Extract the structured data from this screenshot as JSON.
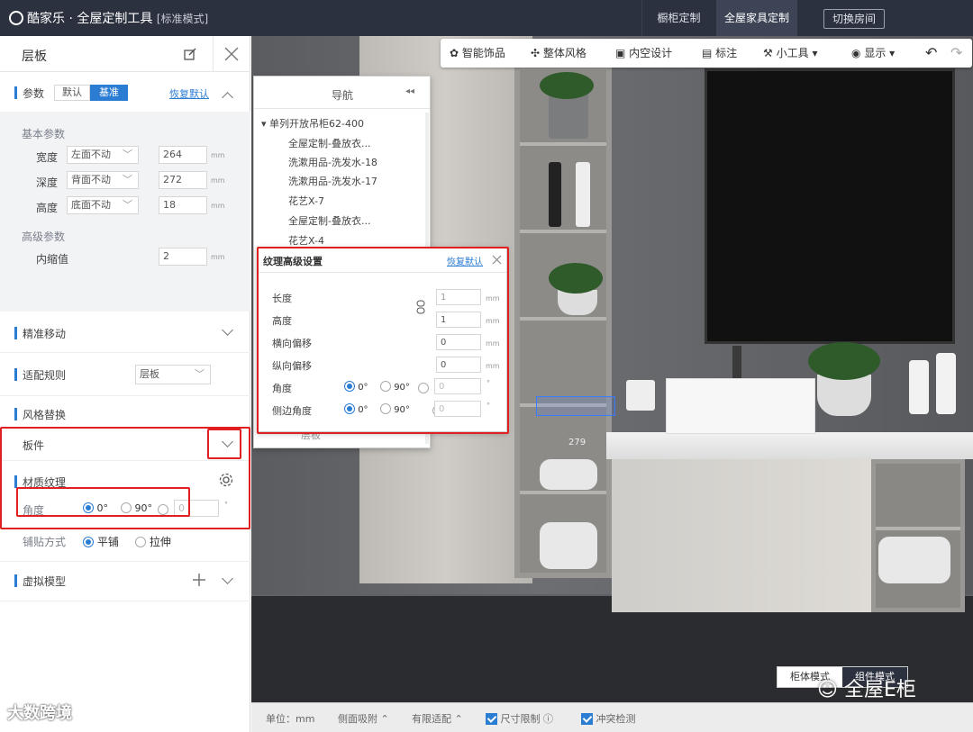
{
  "app": {
    "title": "酷家乐 · 全屋定制工具",
    "mode": "[标准模式]",
    "tabs": [
      "橱柜定制",
      "全屋家具定制"
    ],
    "switch_room": "切换房间"
  },
  "left_panel": {
    "title": "层板",
    "params": {
      "label": "参数",
      "toggle": [
        "默认",
        "基准"
      ],
      "reset": "恢复默认",
      "basic_title": "基本参数",
      "rows": [
        {
          "label": "宽度",
          "anchor": "左面不动",
          "value": "264",
          "unit": "mm"
        },
        {
          "label": "深度",
          "anchor": "背面不动",
          "value": "272",
          "unit": "mm"
        },
        {
          "label": "高度",
          "anchor": "底面不动",
          "value": "18",
          "unit": "mm"
        }
      ],
      "advanced_title": "高级参数",
      "inset": {
        "label": "内缩值",
        "value": "2",
        "unit": "mm"
      }
    },
    "precise_move": "精准移动",
    "fit_rules": {
      "label": "适配规则",
      "value": "层板"
    },
    "style_replace": {
      "label": "风格替换",
      "sub": "板件"
    },
    "material": {
      "label": "材质纹理",
      "angle_label": "角度",
      "angle_options": [
        "0°",
        "90°"
      ],
      "angle_custom": "0",
      "angle_unit": "°",
      "tile_label": "铺贴方式",
      "tile_options": [
        "平铺",
        "拉伸"
      ]
    },
    "virtual_model": "虚拟模型"
  },
  "toolbar": [
    "智能饰品",
    "整体风格",
    "内空设计",
    "标注",
    "小工具",
    "显示"
  ],
  "navigator": {
    "title": "导航",
    "root": "单列开放吊柜62-400",
    "items": [
      "全屋定制-叠放衣...",
      "洗漱用品-洗发水-18",
      "洗漱用品-洗发水-17",
      "花艺X-7",
      "全屋定制-叠放衣...",
      "花艺X-4"
    ],
    "tail": "层板"
  },
  "texture_dialog": {
    "title": "纹理高级设置",
    "reset": "恢复默认",
    "rows": [
      {
        "label": "长度",
        "value": "1",
        "unit": "mm"
      },
      {
        "label": "高度",
        "value": "1",
        "unit": "mm"
      },
      {
        "label": "横向偏移",
        "value": "0",
        "unit": "mm"
      },
      {
        "label": "纵向偏移",
        "value": "0",
        "unit": "mm"
      }
    ],
    "angle_label": "角度",
    "side_angle_label": "侧边角度",
    "angle_options": [
      "0°",
      "90°"
    ],
    "angle_custom": "0",
    "angle_unit": "°"
  },
  "scene": {
    "dimension_label": "279"
  },
  "view_toggle": [
    "柜体模式",
    "组件模式"
  ],
  "statusbar": {
    "unit": "单位：mm",
    "side_snap": "侧面吸附",
    "limited_fit": "有限适配",
    "size_limit": "尺寸限制",
    "collision": "冲突检测"
  },
  "watermarks": [
    "大数跨境",
    "全屋E柜"
  ],
  "colors": {
    "accent": "#2b7cd3",
    "highlight": "#e02020",
    "topbar": "#2c3140"
  }
}
